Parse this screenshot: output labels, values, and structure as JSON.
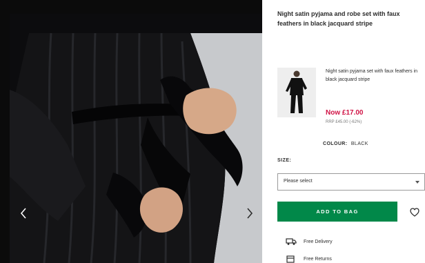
{
  "product": {
    "title": "Night satin pyjama and robe set with faux feathers in black jacquard stripe"
  },
  "variant": {
    "title": "Night satin pyjama set with faux feathers in black jacquard stripe",
    "now_price": "Now £17.00",
    "was_price": "RRP £45.00 (-62%)"
  },
  "colour": {
    "label": "COLOUR:",
    "value": "BLACK"
  },
  "size": {
    "label": "SIZE:",
    "placeholder": "Please select"
  },
  "actions": {
    "add_to_bag": "ADD TO BAG"
  },
  "info": {
    "delivery": "Free Delivery",
    "returns": "Free Returns"
  },
  "colors": {
    "accent_green": "#018849",
    "sale_red": "#d01345",
    "text": "#2d2d2d",
    "image_backdrop": "#0b0b0b"
  },
  "icons": {
    "gallery_prev": "chevron-left-icon",
    "gallery_next": "chevron-right-icon",
    "select_caret": "caret-down-icon",
    "save": "heart-icon",
    "delivery": "truck-icon",
    "returns": "returns-box-icon"
  }
}
